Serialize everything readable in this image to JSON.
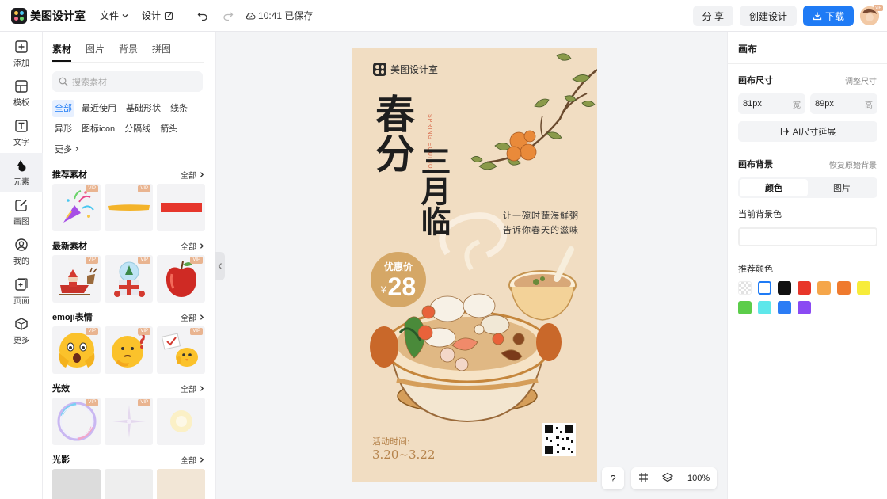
{
  "app": {
    "name": "美图设计室"
  },
  "topbar": {
    "menu": [
      {
        "label": "文件"
      },
      {
        "label": "设计"
      }
    ],
    "save_status": "10:41 已保存",
    "share_label": "分 享",
    "create_label": "创建设计",
    "download_label": "下载",
    "avatar_badge": "VIP"
  },
  "leftnav": {
    "items": [
      {
        "label": "添加",
        "icon": "plus-square-icon"
      },
      {
        "label": "模板",
        "icon": "template-icon"
      },
      {
        "label": "文字",
        "icon": "text-icon"
      },
      {
        "label": "元素",
        "icon": "shapes-icon",
        "active": true
      },
      {
        "label": "画图",
        "icon": "pen-edit-icon"
      },
      {
        "label": "我的",
        "icon": "user-icon"
      },
      {
        "label": "页面",
        "icon": "page-add-icon"
      },
      {
        "label": "更多",
        "icon": "cube-icon"
      }
    ]
  },
  "panel": {
    "tabs": [
      "素材",
      "图片",
      "背景",
      "拼图"
    ],
    "active_tab": "素材",
    "search_placeholder": "搜索素材",
    "chips": [
      "全部",
      "最近使用",
      "基础形状",
      "线条",
      "异形",
      "图标icon",
      "分隔线",
      "箭头",
      "更多"
    ],
    "active_chip": "全部",
    "vip_label": "VIP",
    "sections": [
      {
        "title": "推荐素材",
        "all": "全部",
        "items": [
          "party-popper",
          "yellow-brush-stroke",
          "red-bar"
        ]
      },
      {
        "title": "最新素材",
        "all": "全部",
        "items": [
          "santa-sleigh",
          "snow-globe-gift",
          "red-apple"
        ]
      },
      {
        "title": "emoji表情",
        "all": "全部",
        "items": [
          "scared-face-emoji",
          "thinking-face-emoji",
          "chick-emoji"
        ]
      },
      {
        "title": "光效",
        "all": "全部",
        "items": [
          "bubble-ring",
          "sparkle-star",
          "soft-glow"
        ]
      },
      {
        "title": "光影",
        "all": "全部",
        "items": []
      }
    ]
  },
  "poster": {
    "brand": "美图设计室",
    "headline_left": "春分",
    "headline_right": "三月临",
    "spring_en": "SPRING EQUINOX",
    "poem_line1": "让一碗时蔬海鲜粥",
    "poem_line2": "告诉你春天的滋味",
    "price_label": "优惠价",
    "price_currency": "¥",
    "price_value": "28",
    "event_label": "活动时间:",
    "event_dates": "3.20~3.22"
  },
  "toolbar": {
    "help": "?",
    "zoom": "100%"
  },
  "rightpanel": {
    "title": "画布",
    "size_label": "画布尺寸",
    "size_action": "调整尺寸",
    "width_value": "81px",
    "width_unit": "宽",
    "height_value": "89px",
    "height_unit": "高",
    "ai_expand": "AI尺寸延展",
    "bg_label": "画布背景",
    "bg_reset": "恢复原始背景",
    "bg_tabs": [
      "颜色",
      "图片"
    ],
    "bg_active": "颜色",
    "current_bg_label": "当前背景色",
    "recommended_label": "推荐颜色",
    "swatches": [
      "transparent",
      "#ffffff",
      "#111111",
      "#e8362a",
      "#f5a64a",
      "#ef7a2e",
      "#f7ec3a",
      "#5ccd4a",
      "#5ee7ea",
      "#2b7cf5",
      "#8a4af3"
    ]
  }
}
